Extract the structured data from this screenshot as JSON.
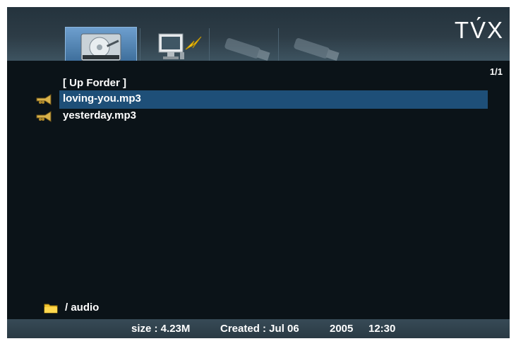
{
  "logo": "TV́X",
  "tabs": [
    {
      "name": "hard-disk",
      "icon": "hdd-icon",
      "selected": true
    },
    {
      "name": "pc",
      "icon": "pc-network-icon",
      "selected": false
    },
    {
      "name": "usb-1",
      "icon": "usb-icon",
      "selected": false
    },
    {
      "name": "usb-2",
      "icon": "usb-icon",
      "selected": false
    }
  ],
  "pager": "1/1",
  "up_folder": "[ Up Forder ]",
  "files": [
    {
      "name": "loving-you.mp3",
      "icon": "trumpet-icon"
    },
    {
      "name": "yesterday.mp3",
      "icon": "trumpet-icon"
    }
  ],
  "path": {
    "icon": "folder-icon",
    "label": "/ audio"
  },
  "status": {
    "size": "size : 4.23M",
    "created": "Created : Jul 06",
    "year": "2005",
    "time": "12:30"
  },
  "colors": {
    "background": "#0b1318",
    "highlight": "#1e4f78",
    "bar": "#2d3c46"
  }
}
